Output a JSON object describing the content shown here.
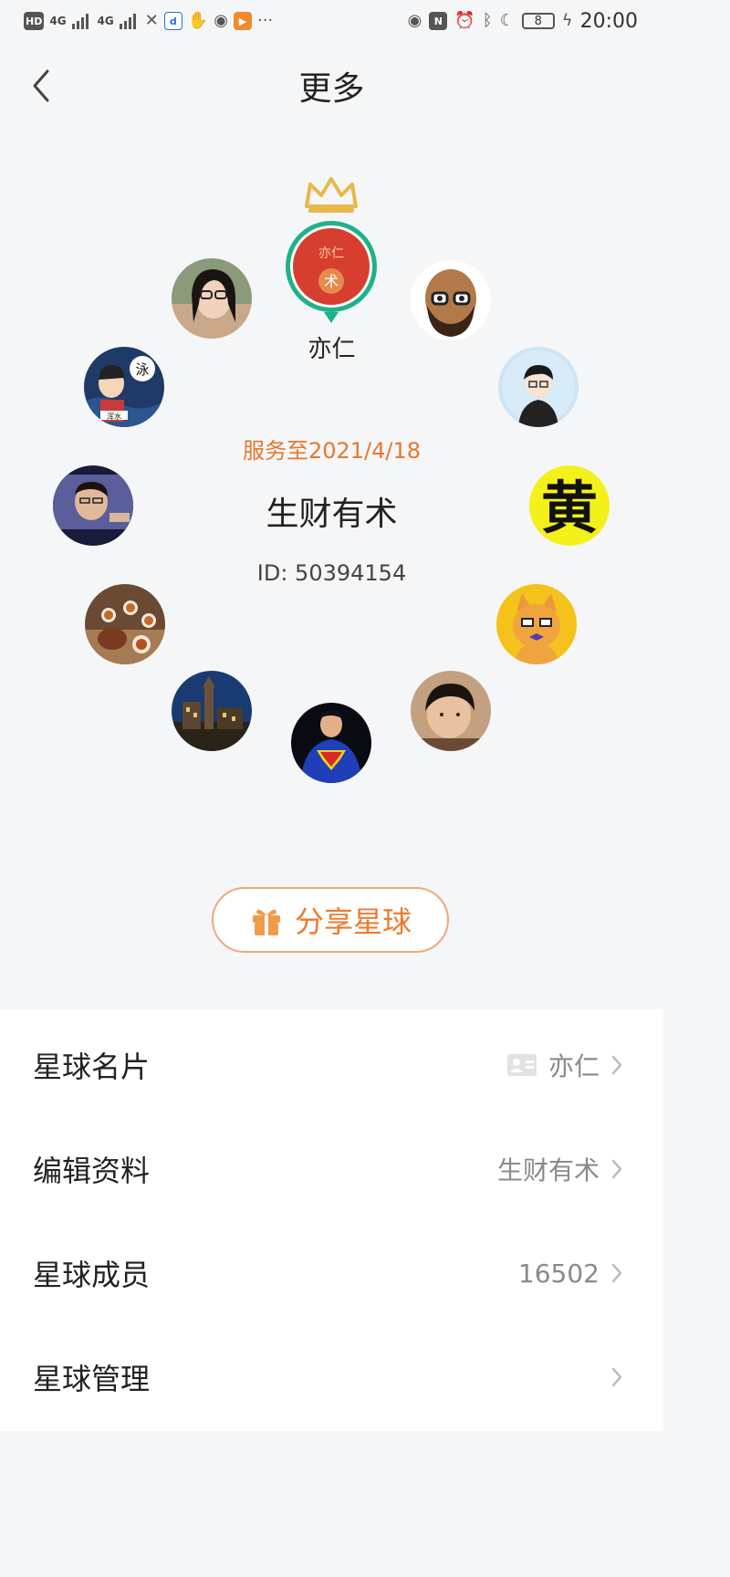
{
  "status_bar": {
    "left_items": [
      "HD",
      "4G",
      "4G"
    ],
    "time": "20:00",
    "battery": "8",
    "more_glyph": "···"
  },
  "header": {
    "title": "更多",
    "back_icon": "chevron-left-icon"
  },
  "owner": {
    "name": "亦仁",
    "avatar_text": "亦仁",
    "avatar_symbol": "术",
    "ring_color": "#1fb28a",
    "avatar_bg": "#d63f2f",
    "crown_color": "#e8b84a"
  },
  "planet": {
    "service_until": "服务至2021/4/18",
    "name": "生财有术",
    "id_text": "ID: 50394154"
  },
  "member_avatars": [
    {
      "name": "member-avatar-woman-glasses"
    },
    {
      "name": "member-avatar-bald-man-glasses"
    },
    {
      "name": "member-avatar-cartoon-yong"
    },
    {
      "name": "member-avatar-cartoon-boy"
    },
    {
      "name": "member-avatar-man-photo",
      "text": ""
    },
    {
      "name": "member-avatar-huang-character",
      "text": "黄"
    },
    {
      "name": "member-avatar-tea-set"
    },
    {
      "name": "member-avatar-cat-cartoon"
    },
    {
      "name": "member-avatar-castle-night"
    },
    {
      "name": "member-avatar-superman"
    },
    {
      "name": "member-avatar-child-photo"
    }
  ],
  "cartoon_labels": {
    "yong": "泳",
    "hunshui": "浑水"
  },
  "share_button": {
    "label": "分享星球",
    "icon": "gift-icon",
    "color": "#ef7a2d"
  },
  "menu": [
    {
      "label": "星球名片",
      "value": "亦仁",
      "icon": "id-card-icon"
    },
    {
      "label": "编辑资料",
      "value": "生财有术"
    },
    {
      "label": "星球成员",
      "value": "16502"
    },
    {
      "label": "星球管理",
      "value": ""
    }
  ]
}
